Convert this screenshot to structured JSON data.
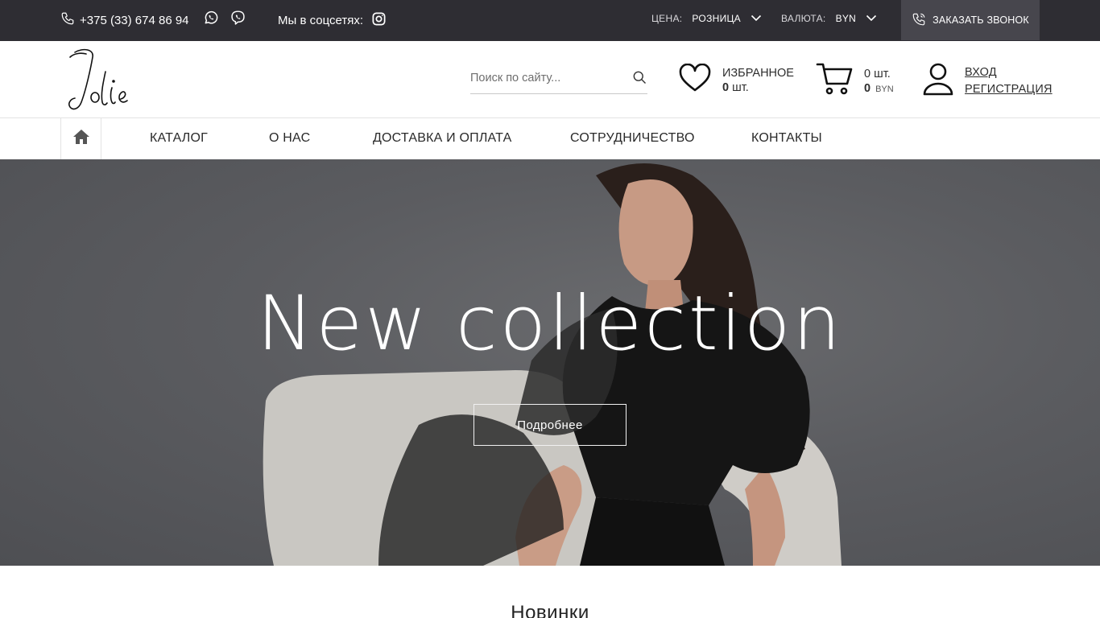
{
  "topbar": {
    "phone": "+375 (33) 674 86 94",
    "social_label": "Мы в соцсетях:",
    "price_label": "ЦЕНА:",
    "price_value": "РОЗНИЦА",
    "currency_label": "ВАЛЮТА:",
    "currency_value": "BYN",
    "callback_label": "ЗАКАЗАТЬ ЗВОНОК"
  },
  "header": {
    "logo_text": "Jolie",
    "search_placeholder": "Поиск по сайту...",
    "favorites_label": "ИЗБРАННОЕ",
    "favorites_count": "0",
    "favorites_unit": "шт.",
    "cart_count": "0 шт.",
    "cart_total": "0",
    "cart_currency": "BYN",
    "login_label": "ВХОД",
    "register_label": "РЕГИСТРАЦИЯ"
  },
  "nav": {
    "items": [
      "КАТАЛОГ",
      "О НАС",
      "ДОСТАВКА И ОПЛАТА",
      "СОТРУДНИЧЕСТВО",
      "КОНТАКТЫ"
    ]
  },
  "hero": {
    "title": "New collection",
    "button_label": "Подробнее"
  },
  "sections": {
    "new_items_title": "Новинки"
  },
  "colors": {
    "topbar_bg": "#2e2d33",
    "callback_bg": "#47464d",
    "hero_bg": "#5b5c60"
  }
}
